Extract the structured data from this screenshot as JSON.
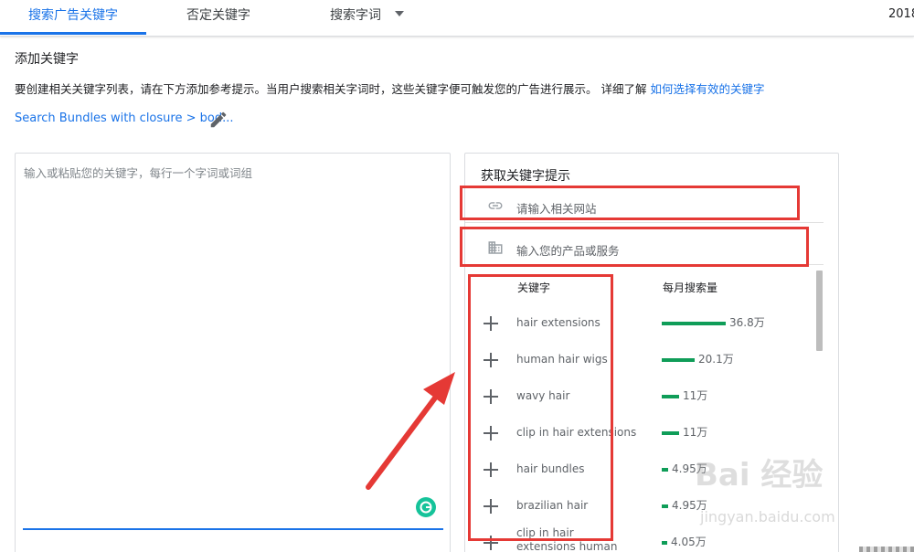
{
  "tabs": [
    {
      "label": "搜索广告关键字",
      "active": true
    },
    {
      "label": "否定关键字",
      "active": false
    },
    {
      "label": "搜索字词",
      "active": false
    }
  ],
  "header_date": "2018",
  "section_title": "添加关键字",
  "description": {
    "text": "要创建相关关键字列表，请在下方添加参考提示。当用户搜索相关字词时，这些关键字便可触发您的广告进行展示。 详细了解",
    "link": "如何选择有效的关键字"
  },
  "bundle_link": "Search Bundles with closure > bod...",
  "left_panel": {
    "placeholder": "输入或粘贴您的关键字，每行一个字词或词组"
  },
  "right_panel": {
    "title": "获取关键字提示",
    "website_placeholder": "请输入相关网站",
    "product_placeholder": "输入您的产品或服务",
    "col_keyword": "关键字",
    "col_volume": "每月搜索量",
    "keywords": [
      {
        "text": "hair extensions",
        "volume": "36.8万",
        "level": 1.0
      },
      {
        "text": "human hair wigs",
        "volume": "20.1万",
        "level": 0.52
      },
      {
        "text": "wavy hair",
        "volume": "11万",
        "level": 0.27
      },
      {
        "text": "clip in hair extensions",
        "volume": "11万",
        "level": 0.27
      },
      {
        "text": "hair bundles",
        "volume": "4.95万",
        "level": 0.1
      },
      {
        "text": "brazilian hair",
        "volume": "4.95万",
        "level": 0.1
      },
      {
        "text": "clip in hair extensions human hair",
        "volume": "4.05万",
        "level": 0.08
      }
    ]
  },
  "watermark": {
    "main": "Bai 经验",
    "sub": "jingyan.baidu.com"
  },
  "colors": {
    "accent": "#1a73e8",
    "bar": "#0f9d58",
    "annotation": "#e53935"
  }
}
